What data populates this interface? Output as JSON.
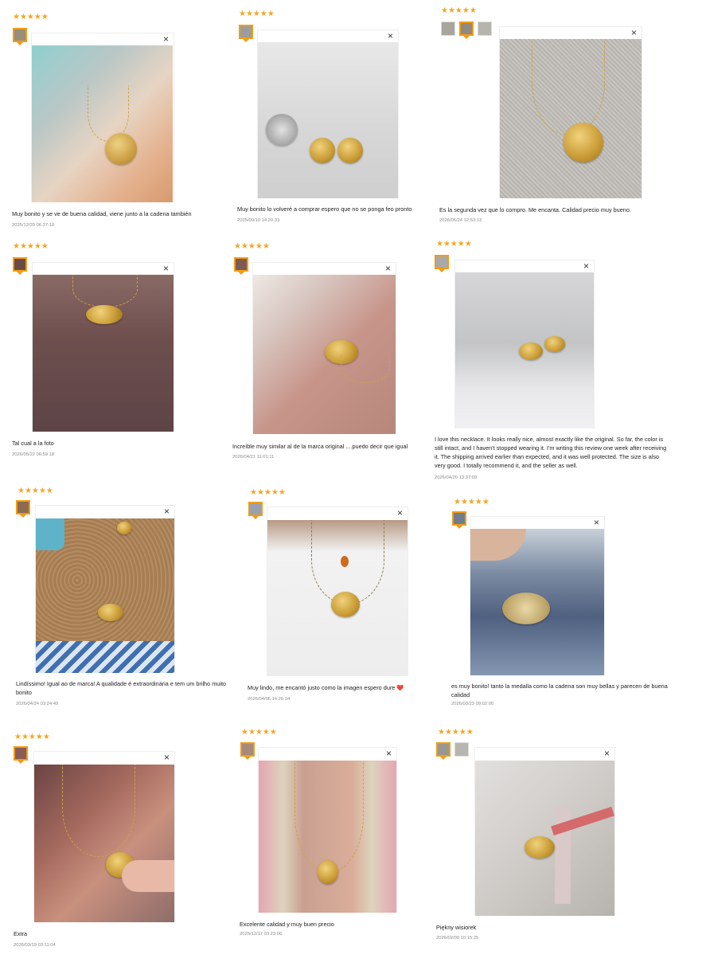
{
  "star_glyph": "★★★★★",
  "close_glyph": "×",
  "reviews": [
    {
      "text": "Muy bonito y se ve de buena calidad, viene junto a la cadena también",
      "date": "2025/12/20 06:37:10"
    },
    {
      "text": "Muy bonito lo volveré a comprar espero que no se ponga feo pronto",
      "date": "2025/09/10 14:20:33"
    },
    {
      "text": "Es la segunda vez que lo compro. Me encanta. Calidad precio muy bueno.",
      "date": "2026/05/24 12:53:13"
    },
    {
      "text": "Tal cual a la foto",
      "date": "2026/05/22 06:59:18"
    },
    {
      "text": "Increíble muy similar al de la marca original ....puedo decir que igual",
      "date": "2026/04/21 11:01:11"
    },
    {
      "text": "I love this necklace. It looks really nice, almost exactly like the original. So far, the color is still intact, and I haven't stopped wearing it. I'm writing this review one week after receiving it. The shipping arrived earlier than expected, and it was well protected. The size is also very good. I totally recommend it, and the seller as well.",
      "date": "2026/04/20 13:37:09"
    },
    {
      "text": "Lindíssimo! Igual ao de marca! A qualidade é extraordinária e tem um brilho muito bonito",
      "date": "2026/04/24 03:24:49"
    },
    {
      "text": "Muy lindo, me encantó justo como la imagen espero dure ❤️",
      "date": "2026/04/06 16:26:34"
    },
    {
      "text": "es muy bonito! tanto la medalla como la cadena son muy bellas y parecen de buena calidad",
      "date": "2026/03/23 09:02:00"
    },
    {
      "text": "Extra",
      "date": "2026/03/19 03:11:04"
    },
    {
      "text": "Excelente calidad y muy buen precio",
      "date": "2025/12/17 03:23:06"
    },
    {
      "text": "Piękny wisiorek",
      "date": "2026/02/09 10:15:25"
    }
  ],
  "colors": {
    "star": "#f5a623",
    "active_thumb_border": "#f39c12",
    "date_text": "#888888"
  }
}
